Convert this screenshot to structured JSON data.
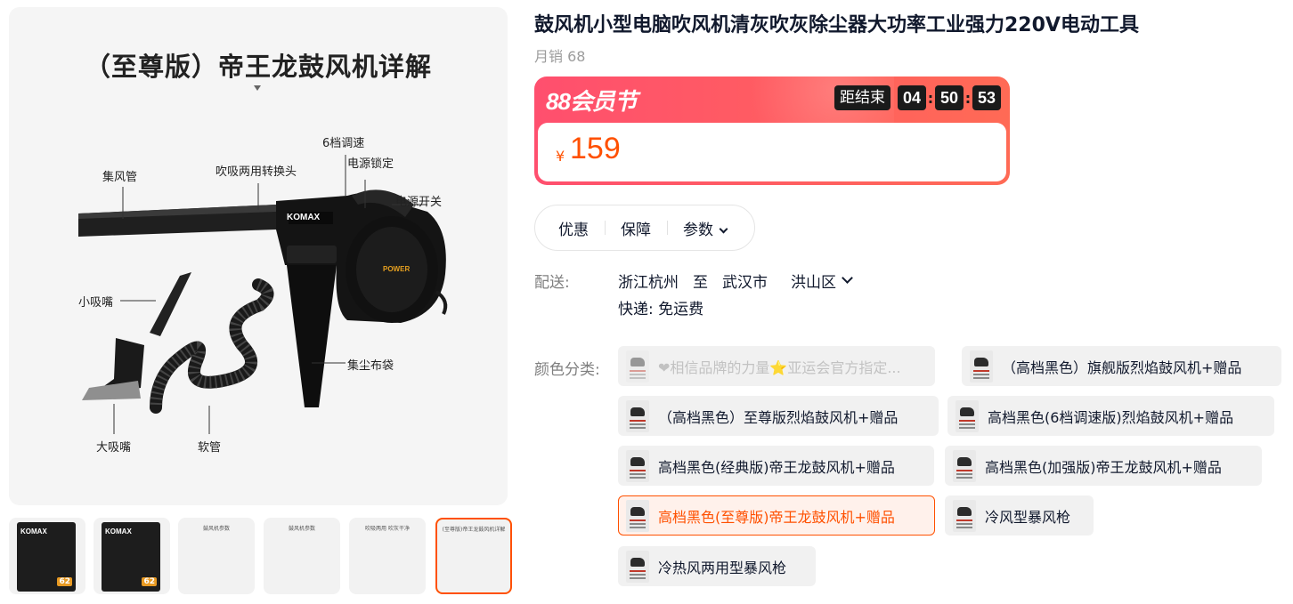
{
  "gallery": {
    "main_image": {
      "title": "（至尊版）帝王龙鼓风机详解",
      "callouts": {
        "speed": "6档调速",
        "power_lock": "电源锁定",
        "collector": "集风管",
        "adapter": "吹吸两用转换头",
        "power_switch": "电源开关",
        "small_nozzle": "小吸嘴",
        "dust_bag": "集尘布袋",
        "large_nozzle": "大吸嘴",
        "hose": "软管"
      },
      "brand_mark": "KOMAX",
      "power_mark": "POWER"
    },
    "thumbnails": [
      {
        "brand": "KOMAX",
        "badge": "62"
      },
      {
        "brand": "KOMAX",
        "badge": "62"
      },
      {
        "caption": "鼓风机参数"
      },
      {
        "caption": "鼓风机参数"
      },
      {
        "caption": "吹吸两用 吹灰干净"
      },
      {
        "caption": "(至尊版)帝王龙鼓风机详解"
      }
    ]
  },
  "product": {
    "title": "鼓风机小型电脑吹风机清灰吹灰除尘器大功率工业强力220V电动工具",
    "monthly_sales": "月销 68"
  },
  "promo": {
    "festival": "88会员节",
    "countdown_label": "距结束",
    "hours": "04",
    "minutes": "50",
    "seconds": "53",
    "currency": "¥",
    "price": "159",
    "colors": {
      "accent": "#ff5000",
      "banner": "#ff4f6e"
    }
  },
  "tabs": {
    "discount": "优惠",
    "guarantee": "保障",
    "params": "参数"
  },
  "delivery": {
    "label": "配送:",
    "from": "浙江杭州",
    "to_word": "至",
    "city": "武汉市",
    "district": "洪山区",
    "express": "快递: 免运费"
  },
  "sku": {
    "label": "颜色分类:",
    "options": [
      "❤相信品牌的力量⭐亚运会官方指定...",
      "（高档黑色）旗舰版烈焰鼓风机+赠品",
      "（高档黑色）至尊版烈焰鼓风机+赠品",
      "高档黑色(6档调速版)烈焰鼓风机+赠品",
      "高档黑色(经典版)帝王龙鼓风机+赠品",
      "高档黑色(加强版)帝王龙鼓风机+赠品",
      "高档黑色(至尊版)帝王龙鼓风机+赠品",
      "冷风型暴风枪",
      "冷热风两用型暴风枪"
    ],
    "selected": "高档黑色(至尊版)帝王龙鼓风机+赠品"
  }
}
